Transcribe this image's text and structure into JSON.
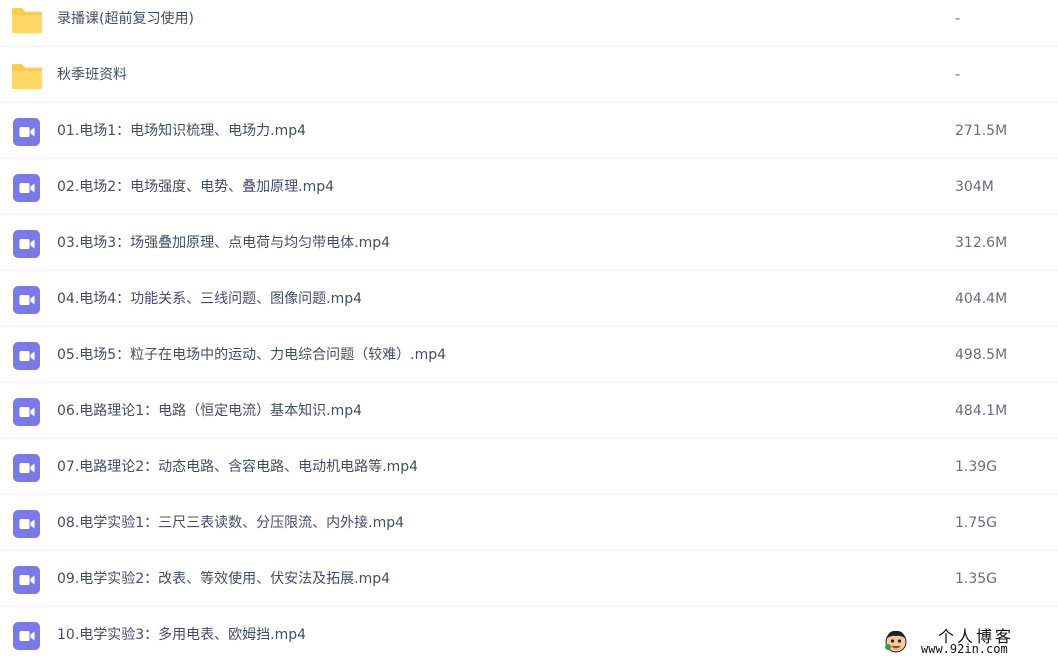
{
  "colors": {
    "folder": "#ffcb4d",
    "video": "#7b79e9",
    "name_text": "#424e67",
    "size_text": "#666e80",
    "divider": "#eef0f4"
  },
  "files": [
    {
      "name": "录播课(超前复习使用)",
      "size": "-",
      "type": "folder",
      "icon": "folder-icon"
    },
    {
      "name": "秋季班资料",
      "size": "-",
      "type": "folder",
      "icon": "folder-icon"
    },
    {
      "name": "01.电场1：电场知识梳理、电场力.mp4",
      "size": "271.5M",
      "type": "video",
      "icon": "video-icon"
    },
    {
      "name": "02.电场2：电场强度、电势、叠加原理.mp4",
      "size": "304M",
      "type": "video",
      "icon": "video-icon"
    },
    {
      "name": "03.电场3：场强叠加原理、点电荷与均匀带电体.mp4",
      "size": "312.6M",
      "type": "video",
      "icon": "video-icon"
    },
    {
      "name": "04.电场4：功能关系、三线问题、图像问题.mp4",
      "size": "404.4M",
      "type": "video",
      "icon": "video-icon"
    },
    {
      "name": "05.电场5：粒子在电场中的运动、力电综合问题（较难）.mp4",
      "size": "498.5M",
      "type": "video",
      "icon": "video-icon"
    },
    {
      "name": "06.电路理论1：电路（恒定电流）基本知识.mp4",
      "size": "484.1M",
      "type": "video",
      "icon": "video-icon"
    },
    {
      "name": "07.电路理论2：动态电路、含容电路、电动机电路等.mp4",
      "size": "1.39G",
      "type": "video",
      "icon": "video-icon"
    },
    {
      "name": "08.电学实验1：三尺三表读数、分压限流、内外接.mp4",
      "size": "1.75G",
      "type": "video",
      "icon": "video-icon"
    },
    {
      "name": "09.电学实验2：改表、等效使用、伏安法及拓展.mp4",
      "size": "1.35G",
      "type": "video",
      "icon": "video-icon"
    },
    {
      "name": "10.电学实验3：多用电表、欧姆挡.mp4",
      "size": "",
      "type": "video",
      "icon": "video-icon"
    }
  ],
  "watermark": {
    "title": "个人博客",
    "url": "www.92in.com"
  }
}
